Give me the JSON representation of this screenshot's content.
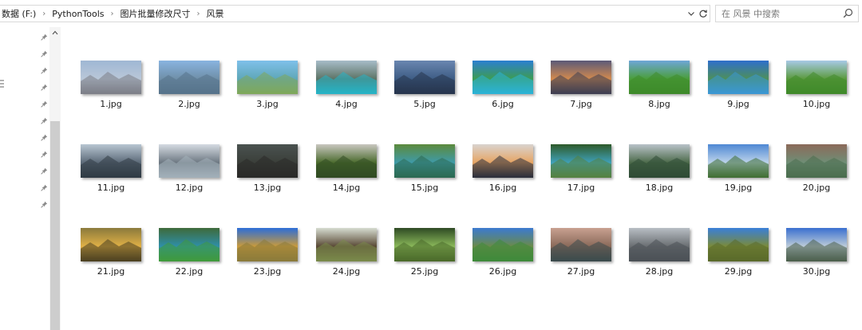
{
  "address_bar": {
    "breadcrumbs": [
      "数据 (F:)",
      "PythonTools",
      "图片批量修改尺寸",
      "风景"
    ]
  },
  "search": {
    "placeholder": "在 风景 中搜索"
  },
  "files": [
    {
      "name": "1.jpg",
      "colors": [
        "#9fb7d4",
        "#b9c7d8",
        "#7c7e86"
      ]
    },
    {
      "name": "2.jpg",
      "colors": [
        "#89b4e0",
        "#6f8fa8",
        "#56728a"
      ]
    },
    {
      "name": "3.jpg",
      "colors": [
        "#7fc0ea",
        "#5fa7b8",
        "#7fa85a"
      ]
    },
    {
      "name": "4.jpg",
      "colors": [
        "#a7bcc9",
        "#5d7466",
        "#25b5c7"
      ]
    },
    {
      "name": "5.jpg",
      "colors": [
        "#6a86b0",
        "#3e5d85",
        "#27344d"
      ]
    },
    {
      "name": "6.jpg",
      "colors": [
        "#2b7fd1",
        "#3d9c52",
        "#2bb3d8"
      ]
    },
    {
      "name": "7.jpg",
      "colors": [
        "#5b5a78",
        "#d28a4e",
        "#3d3e52"
      ]
    },
    {
      "name": "8.jpg",
      "colors": [
        "#6ea6d8",
        "#4a9e3a",
        "#3e8a2a"
      ]
    },
    {
      "name": "9.jpg",
      "colors": [
        "#2f6fcc",
        "#4d8f5a",
        "#3b98d6"
      ]
    },
    {
      "name": "10.jpg",
      "colors": [
        "#a8c9e6",
        "#5b9a3e",
        "#3f8a2a"
      ]
    },
    {
      "name": "11.jpg",
      "colors": [
        "#b8c6d2",
        "#5c6a78",
        "#2f3a44"
      ]
    },
    {
      "name": "12.jpg",
      "colors": [
        "#d5dbe2",
        "#6d7882",
        "#a3b0ba"
      ]
    },
    {
      "name": "13.jpg",
      "colors": [
        "#4a5250",
        "#3b3f3a",
        "#2a2a28"
      ]
    },
    {
      "name": "14.jpg",
      "colors": [
        "#c9c7c0",
        "#4b6b2d",
        "#2f4a22"
      ]
    },
    {
      "name": "15.jpg",
      "colors": [
        "#5c8a3c",
        "#3f9aa8",
        "#2c6a52"
      ]
    },
    {
      "name": "16.jpg",
      "colors": [
        "#d9d3cf",
        "#e6a463",
        "#2a2d3b"
      ]
    },
    {
      "name": "17.jpg",
      "colors": [
        "#2e5a2a",
        "#3fa0b8",
        "#55823f"
      ]
    },
    {
      "name": "18.jpg",
      "colors": [
        "#b9c2c9",
        "#4c6a4a",
        "#2e4a34"
      ]
    },
    {
      "name": "19.jpg",
      "colors": [
        "#4e88d4",
        "#bcd3ea",
        "#3f6e32"
      ]
    },
    {
      "name": "20.jpg",
      "colors": [
        "#8c6a5a",
        "#6f8e76",
        "#4a6e4e"
      ]
    },
    {
      "name": "21.jpg",
      "colors": [
        "#8a7a3c",
        "#e0b046",
        "#4a3f20"
      ]
    },
    {
      "name": "22.jpg",
      "colors": [
        "#3e6a3a",
        "#2f8fa8",
        "#3f9a3a"
      ]
    },
    {
      "name": "23.jpg",
      "colors": [
        "#2d6ed8",
        "#c89a3c",
        "#8a7a3a"
      ]
    },
    {
      "name": "24.jpg",
      "colors": [
        "#d6dcd0",
        "#5a4a36",
        "#7a8a4a"
      ]
    },
    {
      "name": "25.jpg",
      "colors": [
        "#2e4a24",
        "#8ab85a",
        "#4a6a2a"
      ]
    },
    {
      "name": "26.jpg",
      "colors": [
        "#3c7ad0",
        "#6a8a4a",
        "#3e8a3a"
      ]
    },
    {
      "name": "27.jpg",
      "colors": [
        "#c8a090",
        "#8a6a5a",
        "#3a4a4c"
      ]
    },
    {
      "name": "28.jpg",
      "colors": [
        "#b8bec4",
        "#6a6e72",
        "#4a5056"
      ]
    },
    {
      "name": "29.jpg",
      "colors": [
        "#3a7fd8",
        "#7a8a3a",
        "#5a6a2a"
      ]
    },
    {
      "name": "30.jpg",
      "colors": [
        "#3a6fd0",
        "#bccbd8",
        "#4a5e4a"
      ]
    }
  ]
}
